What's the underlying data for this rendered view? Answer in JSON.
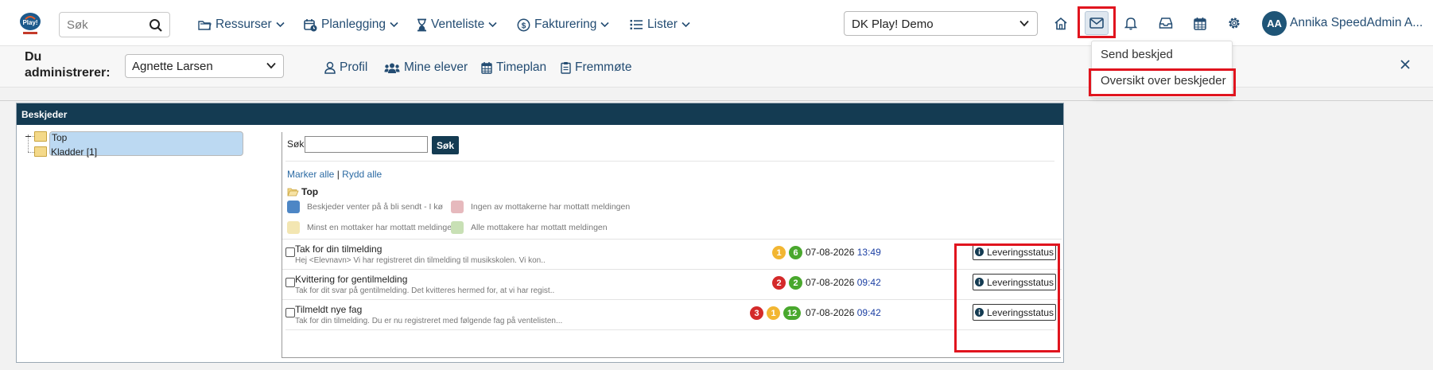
{
  "topbar": {
    "search_placeholder": "Søk",
    "nav": [
      {
        "label": "Ressurser"
      },
      {
        "label": "Planlegging"
      },
      {
        "label": "Venteliste"
      },
      {
        "label": "Fakturering"
      },
      {
        "label": "Lister"
      }
    ],
    "school_select": "DK Play! Demo",
    "user_initials": "AA",
    "user_name": "Annika SpeedAdmin A..."
  },
  "adminbar": {
    "du_label_1": "Du",
    "du_label_2": "administrerer:",
    "selected_student": "Agnette Larsen",
    "links": [
      {
        "label": "Profil"
      },
      {
        "label": "Mine elever"
      },
      {
        "label": "Timeplan"
      },
      {
        "label": "Fremmøte"
      }
    ]
  },
  "mail_dropdown": {
    "items": [
      {
        "label": "Send beskjed"
      },
      {
        "label": "Oversikt over beskjeder"
      }
    ]
  },
  "panel": {
    "title": "Beskjeder",
    "tree": [
      {
        "label": "Top"
      },
      {
        "label": "Kladder [1]"
      }
    ],
    "search_label": "Søk",
    "search_button": "Søk",
    "select_all": "Marker alle",
    "link_sep": "|",
    "clear_all": "Rydd alle",
    "current_folder": "Top",
    "legend": [
      {
        "label": "Beskjeder venter på å bli sendt - I kø",
        "color": "#4d86c5"
      },
      {
        "label": "Ingen av mottakerne har mottatt meldingen",
        "color": "#e6b9bd"
      },
      {
        "label": "Minst en mottaker har mottatt meldingen",
        "color": "#f3e6b2"
      },
      {
        "label": "Alle mottakere har mottatt meldingen",
        "color": "#c8e0b5"
      }
    ],
    "delivery_button": "Leveringsstatus",
    "messages": [
      {
        "subject": "Tak for din tilmelding",
        "preview": "Hej <Elevnavn> Vi har registreret din tilmelding til musikskolen. Vi kon..",
        "badges": [
          {
            "value": "1",
            "color": "#f2b632"
          },
          {
            "value": "6",
            "color": "#49a82d"
          }
        ],
        "date": "07-08-2026",
        "time": "13:49"
      },
      {
        "subject": "Kvittering for gentilmelding",
        "preview": "Tak for dit svar på gentilmelding. Det kvitteres hermed for, at vi har regist..",
        "badges": [
          {
            "value": "2",
            "color": "#d42a2a"
          },
          {
            "value": "2",
            "color": "#49a82d"
          }
        ],
        "date": "07-08-2026",
        "time": "09:42"
      },
      {
        "subject": "Tilmeldt nye fag",
        "preview": "Tak for din tilmelding. Du er nu registreret med følgende fag på ventelisten...",
        "badges": [
          {
            "value": "3",
            "color": "#d42a2a"
          },
          {
            "value": "1",
            "color": "#f2b632"
          },
          {
            "value": "12",
            "color": "#49a82d"
          }
        ],
        "date": "07-08-2026",
        "time": "09:42"
      }
    ]
  }
}
